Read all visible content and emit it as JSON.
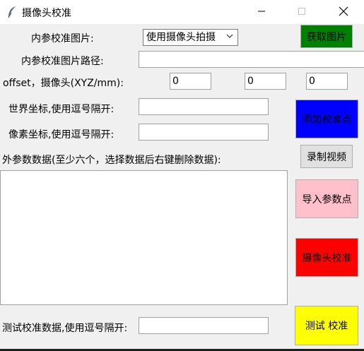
{
  "window": {
    "title": "摄像头校准",
    "icon": "feather-icon",
    "controls": {
      "minimize": "—",
      "close": "✕"
    }
  },
  "intrinsic": {
    "image_label": "内参校准图片:",
    "image_source_selected": "使用摄像头拍摄",
    "get_image_button": "获取图片",
    "path_label": "内参校准图片路径:",
    "path_value": ""
  },
  "offset": {
    "label": "offset，摄像头(XYZ/mm):",
    "x": "0",
    "y": "0",
    "z": "0"
  },
  "coords": {
    "world_label": "世界坐标,使用逗号隔开:",
    "world_value": "",
    "pixel_label": "像素坐标,使用逗号隔开:",
    "pixel_value": "",
    "add_point_button": "添加校准点"
  },
  "extrinsic": {
    "label": "外参数数据(至少六个，选择数据后右键删除数据):",
    "record_video_button": "录制视频",
    "import_points_button": "导入参数点",
    "calibrate_button": "摄像头校准",
    "items": []
  },
  "test": {
    "label": "测试校准数据,使用逗号隔开:",
    "value": "",
    "test_button": "测试  校准"
  },
  "colors": {
    "get_image_bg": "#008000",
    "add_point_bg": "#0000ff",
    "import_points_bg": "#ffc0cb",
    "calibrate_bg": "#ff0000",
    "test_bg": "#ffff00"
  }
}
